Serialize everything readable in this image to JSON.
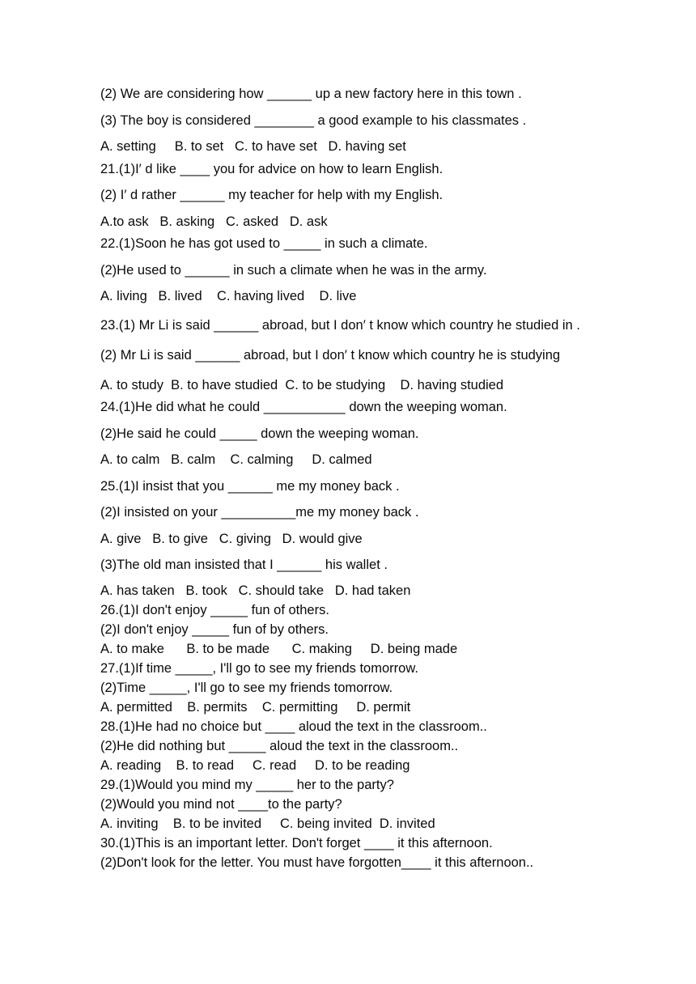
{
  "document": {
    "type": "grammar-exercise-worksheet",
    "background_color": "#ffffff",
    "text_color": "#0a0a0a"
  },
  "lines": {
    "l01": "(2) We are considering how ______ up a new factory here in this town .",
    "l02": "(3) The boy is considered ________ a good example to his classmates .",
    "l03": "A. setting     B. to set   C. to have set   D. having set",
    "l04": "21.(1)I′ d like ____ you for advice on how to learn English.",
    "l05": "(2) I′ d rather ______ my teacher for help with my English.",
    "l06": "A.to ask   B. asking   C. asked   D. ask",
    "l07": "22.(1)Soon he has got used to _____ in such a climate.",
    "l08": "(2)He used to ______ in such a climate when he was in the army.",
    "l09": "A. living   B. lived    C. having lived    D. live",
    "l10": "23.(1) Mr Li is said ______ abroad, but I don′ t know which country he studied in .",
    "l11": "(2) Mr Li is said ______ abroad, but I don′ t know which country he is studying",
    "l12": "A. to study  B. to have studied  C. to be studying    D. having studied",
    "l13": "24.(1)He did what he could ___________ down the weeping woman.",
    "l14": "(2)He said he could _____ down the weeping woman.",
    "l15": "A. to calm   B. calm    C. calming     D. calmed",
    "l16": "25.(1)I insist that you ______ me my money back .",
    "l17": "(2)I insisted on your __________me my money back .",
    "l18": "A. give   B. to give   C. giving   D. would give",
    "l19": "(3)The old man insisted that I ______ his wallet .",
    "l20": "A. has taken   B. took   C. should take   D. had taken",
    "l21": "26.(1)I don't enjoy _____ fun of others.",
    "l22": "(2)I don't enjoy _____ fun of by others.",
    "l23": "A. to make      B. to be made      C. making     D. being made",
    "l24": "27.(1)If time _____, I'll go to see my friends tomorrow.",
    "l25": "(2)Time _____, I'll go to see my friends tomorrow.",
    "l26": "A. permitted    B. permits    C. permitting     D. permit",
    "l27": "28.(1)He had no choice but ____ aloud the text in the classroom..",
    "l28": "(2)He did nothing but _____ aloud the text in the classroom..",
    "l29": "A. reading    B. to read     C. read     D. to be reading",
    "l30": "29.(1)Would you mind my _____ her to the party?",
    "l31": "(2)Would you mind not ____to the party?",
    "l32": "A. inviting    B. to be invited     C. being invited  D. invited",
    "l33": "30.(1)This is an important letter. Don't forget ____ it this afternoon.",
    "l34": "(2)Don't look for the letter. You must have forgotten____ it this afternoon.."
  }
}
